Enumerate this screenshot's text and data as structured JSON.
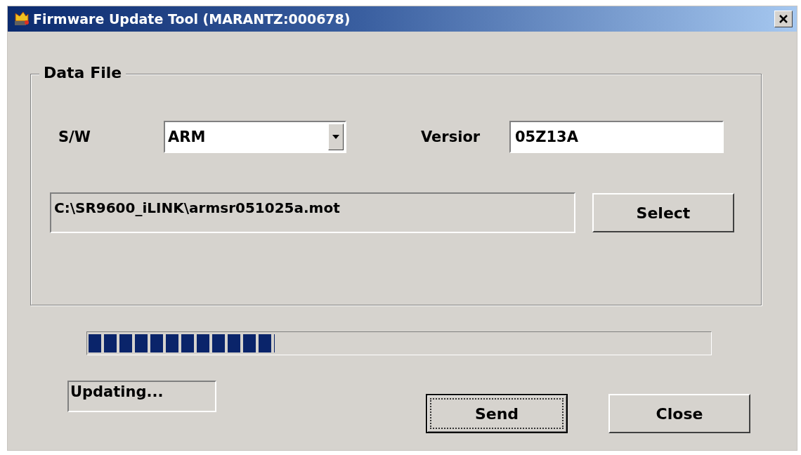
{
  "window": {
    "title": "Firmware Update Tool (MARANTZ:000678)"
  },
  "group": {
    "title": "Data File",
    "sw": {
      "label": "S/W",
      "value": "ARM"
    },
    "version": {
      "label": "Versior",
      "value": "05Z13A"
    },
    "path": {
      "value": "C:\\SR9600_iLINK\\armsr051025a.mot"
    },
    "select_button": {
      "label": "Select"
    }
  },
  "progress": {
    "level": 0.3
  },
  "status": {
    "text": "Updating..."
  },
  "buttons": [
    {
      "label": "Send",
      "focused": true
    },
    {
      "label": "Close",
      "focused": false
    }
  ]
}
